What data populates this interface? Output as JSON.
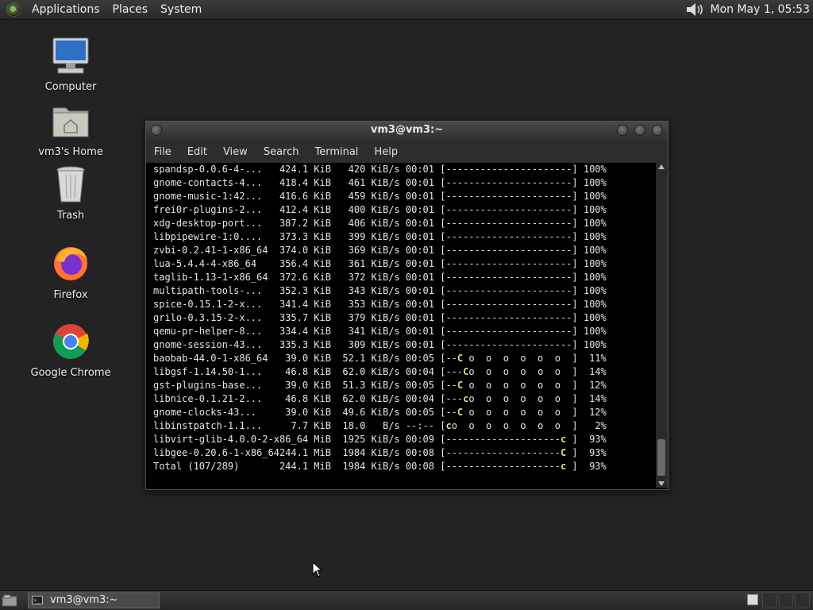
{
  "top_panel": {
    "menus": [
      "Applications",
      "Places",
      "System"
    ],
    "clock": "Mon May  1, 05:53"
  },
  "desktop": {
    "icons": [
      {
        "label": "Computer"
      },
      {
        "label": "vm3's Home"
      },
      {
        "label": "Trash"
      },
      {
        "label": "Firefox"
      },
      {
        "label": "Google Chrome"
      }
    ]
  },
  "terminal": {
    "title": "vm3@vm3:~",
    "menu": [
      "File",
      "Edit",
      "View",
      "Search",
      "Terminal",
      "Help"
    ],
    "lines": [
      "spandsp-0.0.6-4-...   424.1 KiB   420 KiB/s 00:01 [----------------------] 100%",
      "gnome-contacts-4...   418.4 KiB   461 KiB/s 00:01 [----------------------] 100%",
      "gnome-music-1:42...   416.6 KiB   459 KiB/s 00:01 [----------------------] 100%",
      "frei0r-plugins-2...   412.4 KiB   400 KiB/s 00:01 [----------------------] 100%",
      "xdg-desktop-port...   387.2 KiB   406 KiB/s 00:01 [----------------------] 100%",
      "libpipewire-1:0....   373.3 KiB   399 KiB/s 00:01 [----------------------] 100%",
      "zvbi-0.2.41-1-x86_64  374.0 KiB   369 KiB/s 00:01 [----------------------] 100%",
      "lua-5.4.4-4-x86_64    356.4 KiB   361 KiB/s 00:01 [----------------------] 100%",
      "taglib-1.13-1-x86_64  372.6 KiB   372 KiB/s 00:01 [----------------------] 100%",
      "multipath-tools-...   352.3 KiB   343 KiB/s 00:01 [----------------------] 100%",
      "spice-0.15.1-2-x...   341.4 KiB   353 KiB/s 00:01 [----------------------] 100%",
      "grilo-0.3.15-2-x...   335.7 KiB   379 KiB/s 00:01 [----------------------] 100%",
      "qemu-pr-helper-8...   334.4 KiB   341 KiB/s 00:01 [----------------------] 100%",
      "gnome-session-43...   335.3 KiB   309 KiB/s 00:01 [----------------------] 100%",
      "baobab-44.0-1-x86_64   39.0 KiB  52.1 KiB/s 00:05 [--C o  o  o  o  o  o  ]  11%",
      "libgsf-1.14.50-1...    46.8 KiB  62.0 KiB/s 00:04 [---Co  o  o  o  o  o  ]  14%",
      "gst-plugins-base...    39.0 KiB  51.3 KiB/s 00:05 [--C o  o  o  o  o  o  ]  12%",
      "libnice-0.1.21-2...    46.8 KiB  62.0 KiB/s 00:04 [---co  o  o  o  o  o  ]  14%",
      "gnome-clocks-43...     39.0 KiB  49.6 KiB/s 00:05 [--C o  o  o  o  o  o  ]  12%",
      "libinstpatch-1.1...     7.7 KiB  18.0   B/s --:-- [co  o  o  o  o  o  o  ]   2%",
      "libvirt-glib-4.0.0-2-x86_64 MiB  1925 KiB/s 00:09 [--------------------c ]  93%",
      "libgee-0.20.6-1-x86_64244.1 MiB  1984 KiB/s 00:08 [--------------------C ]  93%",
      "Total (107/289)       244.1 MiB  1984 KiB/s 00:08 [--------------------c ]  93%"
    ]
  },
  "taskbar": {
    "task_label": "vm3@vm3:~"
  }
}
